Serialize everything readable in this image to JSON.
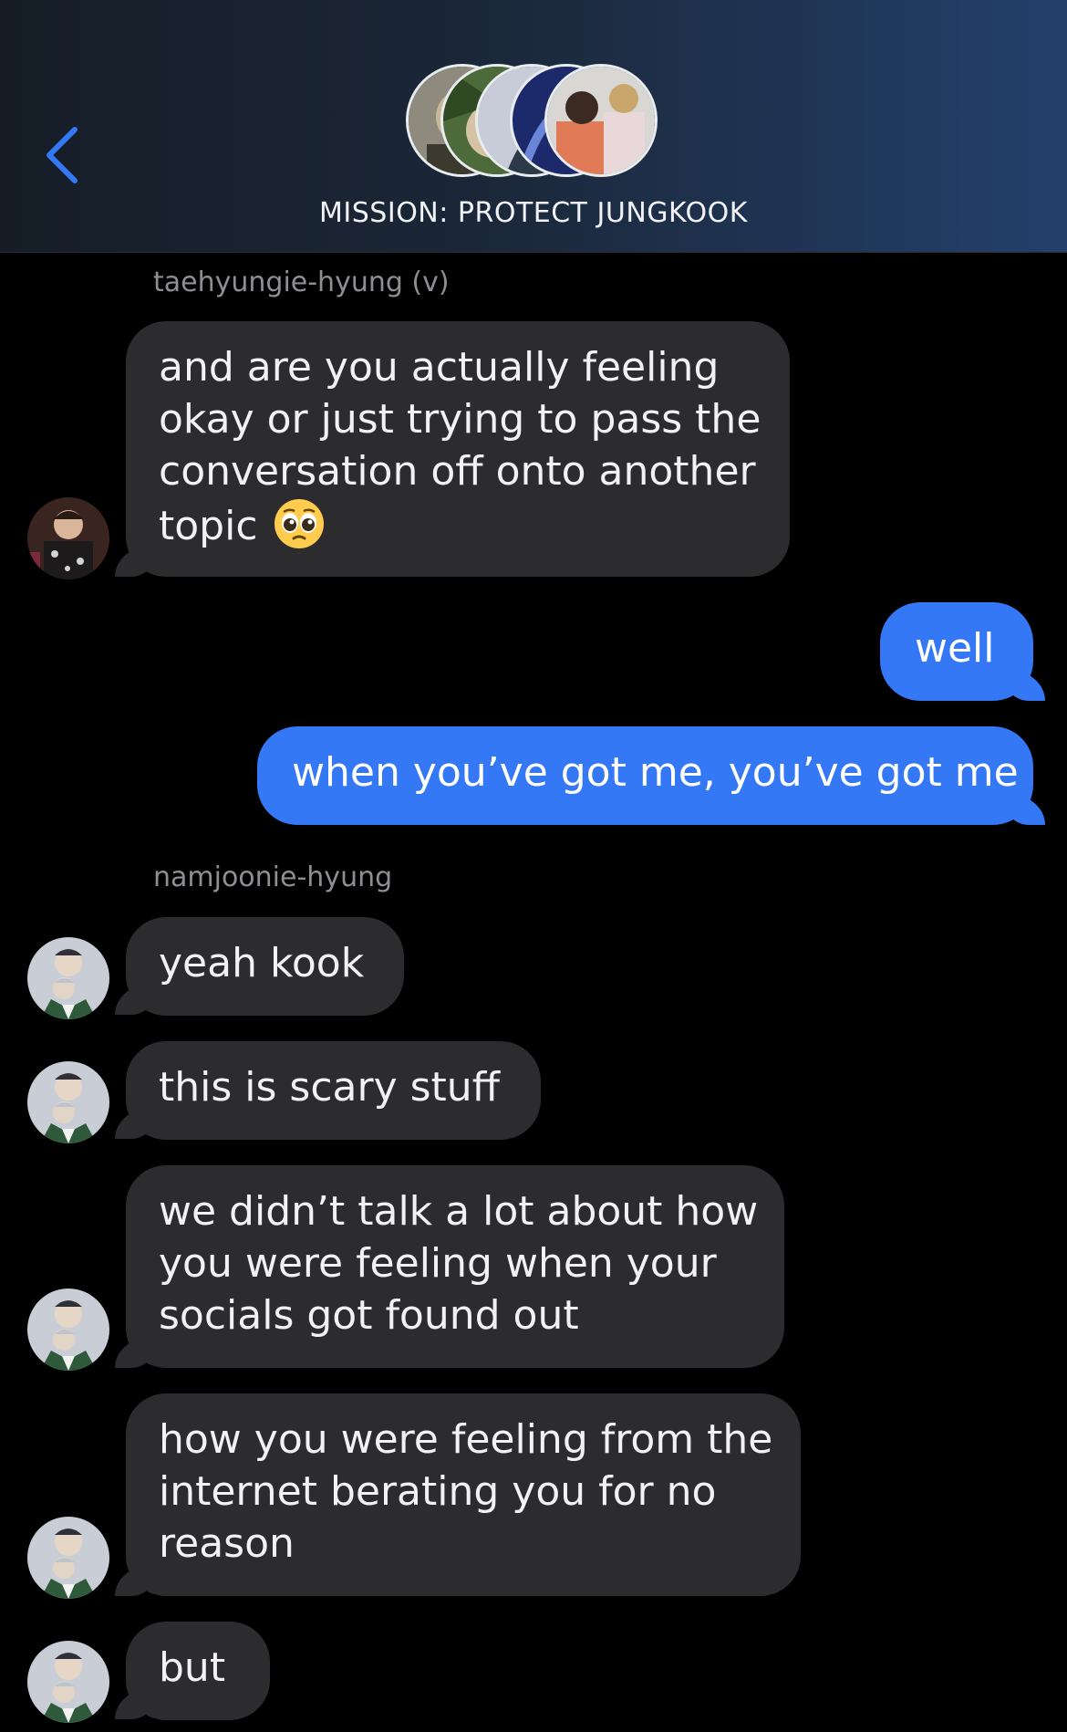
{
  "header": {
    "title": "MISSION: PROTECT JUNGKOOK",
    "back_icon": "chevron-left-icon",
    "accent": "#3478f6"
  },
  "thread": {
    "sender_1": "taehyungie-hyung (v)",
    "msg_1_lines": [
      "and are you actually feeling",
      "okay or just trying to pass the",
      "conversation off onto another",
      "topic"
    ],
    "msg_1_emoji": "pleading-face-emoji",
    "out_1": "well",
    "out_2": "when you’ve got me, you’ve got me",
    "sender_2": "namjoonie-hyung",
    "msg_2": "yeah kook",
    "msg_3": "this is scary stuff",
    "msg_4_lines": [
      "we didn’t talk a lot about how",
      "you were feeling when your",
      "socials got found out"
    ],
    "msg_5_lines": [
      "how you were feeling from the",
      "internet berating you for no",
      "reason"
    ],
    "msg_6": "but"
  },
  "colors": {
    "incoming_bubble": "#2c2c2e",
    "outgoing_bubble": "#3478f6",
    "sender_label": "#8e8e93",
    "background": "#000000"
  }
}
